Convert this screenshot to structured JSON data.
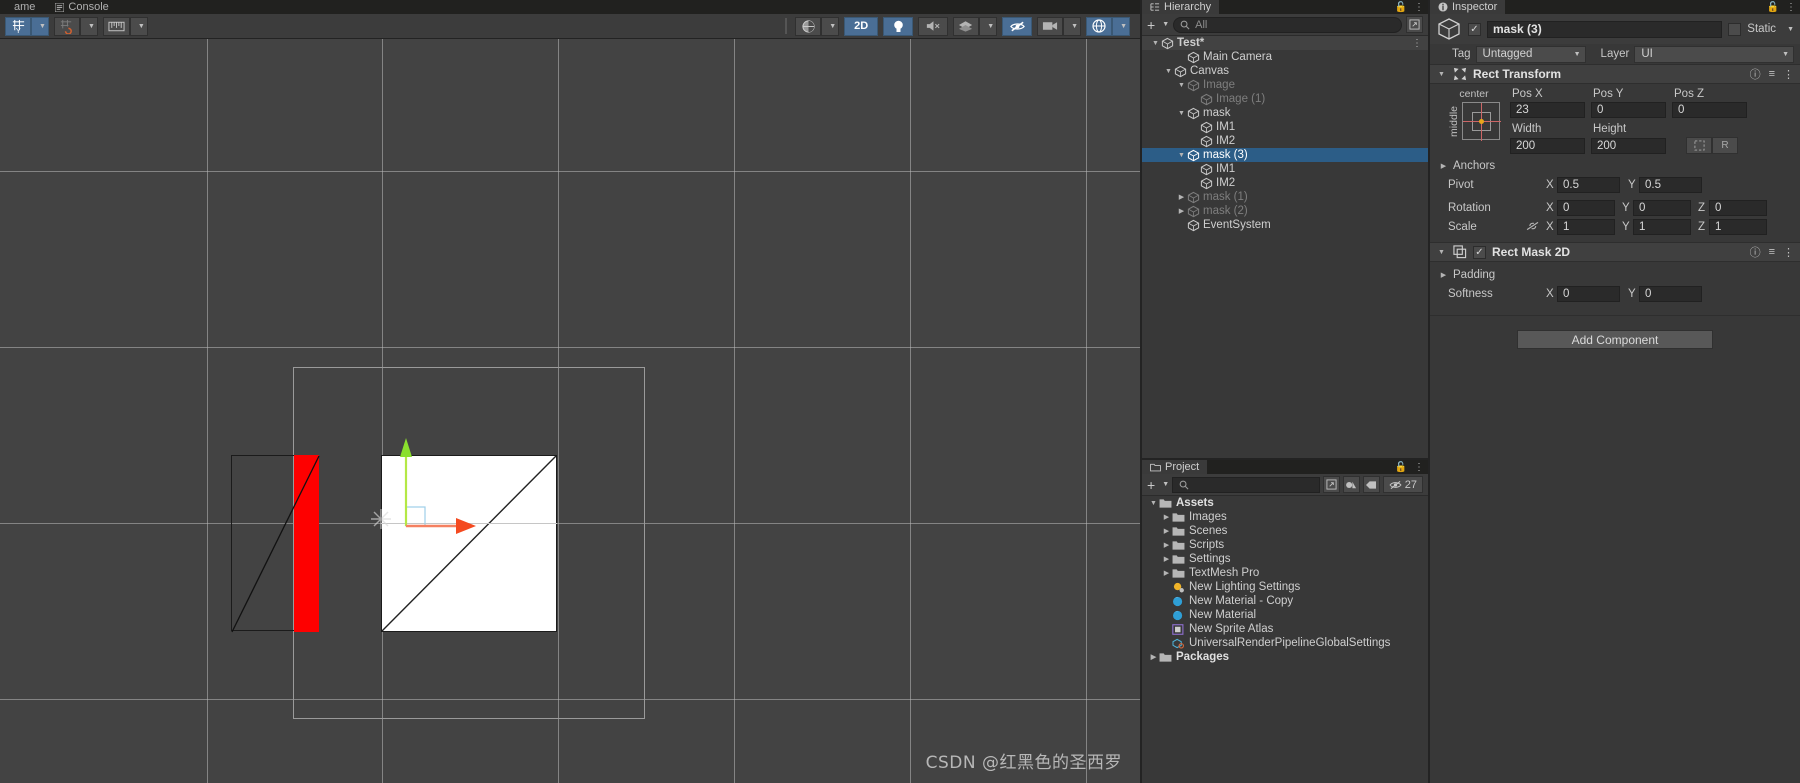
{
  "scene": {
    "tabs": [
      {
        "label": "ame",
        "icon": "scene-icon",
        "active": false
      },
      {
        "label": "Console",
        "icon": "console-icon",
        "active": false
      }
    ],
    "toolbar": {
      "grid_snap_label": "grid-snapping-icon",
      "snap_increment_label": "snap-increment-icon",
      "ruler_label": "ruler-icon",
      "draw_mode_label": "shaded-icon",
      "mode_2d_label": "2D",
      "lighting_label": "lighting-icon",
      "audio_label": "audio-mute-icon",
      "fx_label": "effects-icon",
      "hidden_label": "visibility-off-icon",
      "camera_label": "scene-camera-icon",
      "gizmos_label": "gizmos-icon"
    },
    "watermark": "CSDN @红黑色的圣西罗",
    "objects": {
      "canvas_outline": "canvas-rect",
      "masked_image_rect": "mask-rect",
      "red_strip": "red-image",
      "white_square": "selected-image",
      "gizmo_x_axis": "x-axis-arrow",
      "gizmo_y_axis": "y-axis-arrow",
      "gizmo_z_handle": "z-plane-handle"
    }
  },
  "hierarchy": {
    "tab_label": "Hierarchy",
    "add_label": "+",
    "search_placeholder": "All",
    "rows": [
      {
        "label": "Test*",
        "depth": 0,
        "twist": "down",
        "root": true,
        "selected": false,
        "faded": false,
        "unity_icon": true
      },
      {
        "label": "Main Camera",
        "depth": 2,
        "twist": "none",
        "root": false,
        "selected": false,
        "faded": false
      },
      {
        "label": "Canvas",
        "depth": 1,
        "twist": "down",
        "root": false,
        "selected": false,
        "faded": false
      },
      {
        "label": "Image",
        "depth": 2,
        "twist": "down",
        "root": false,
        "selected": false,
        "faded": true
      },
      {
        "label": "Image (1)",
        "depth": 3,
        "twist": "none",
        "root": false,
        "selected": false,
        "faded": true
      },
      {
        "label": "mask",
        "depth": 2,
        "twist": "down",
        "root": false,
        "selected": false,
        "faded": false
      },
      {
        "label": "IM1",
        "depth": 3,
        "twist": "none",
        "root": false,
        "selected": false,
        "faded": false
      },
      {
        "label": "IM2",
        "depth": 3,
        "twist": "none",
        "root": false,
        "selected": false,
        "faded": false
      },
      {
        "label": "mask (3)",
        "depth": 2,
        "twist": "down",
        "root": false,
        "selected": true,
        "faded": false
      },
      {
        "label": "IM1",
        "depth": 3,
        "twist": "none",
        "root": false,
        "selected": false,
        "faded": false
      },
      {
        "label": "IM2",
        "depth": 3,
        "twist": "none",
        "root": false,
        "selected": false,
        "faded": false
      },
      {
        "label": "mask (1)",
        "depth": 2,
        "twist": "right",
        "root": false,
        "selected": false,
        "faded": true
      },
      {
        "label": "mask (2)",
        "depth": 2,
        "twist": "right",
        "root": false,
        "selected": false,
        "faded": true
      },
      {
        "label": "EventSystem",
        "depth": 2,
        "twist": "none",
        "root": false,
        "selected": false,
        "faded": false
      }
    ]
  },
  "project": {
    "tab_label": "Project",
    "add_label": "+",
    "search_placeholder": "",
    "visible_count": "27",
    "rows": [
      {
        "label": "Assets",
        "depth": 0,
        "twist": "down",
        "icon": "folder",
        "bold": true
      },
      {
        "label": "Images",
        "depth": 1,
        "twist": "right",
        "icon": "folder",
        "bold": false
      },
      {
        "label": "Scenes",
        "depth": 1,
        "twist": "right",
        "icon": "folder",
        "bold": false
      },
      {
        "label": "Scripts",
        "depth": 1,
        "twist": "right",
        "icon": "folder",
        "bold": false
      },
      {
        "label": "Settings",
        "depth": 1,
        "twist": "right",
        "icon": "folder",
        "bold": false
      },
      {
        "label": "TextMesh Pro",
        "depth": 1,
        "twist": "right",
        "icon": "folder",
        "bold": false
      },
      {
        "label": "New Lighting Settings",
        "depth": 1,
        "twist": "none",
        "icon": "lighting",
        "bold": false
      },
      {
        "label": "New Material - Copy",
        "depth": 1,
        "twist": "none",
        "icon": "material",
        "bold": false
      },
      {
        "label": "New Material",
        "depth": 1,
        "twist": "none",
        "icon": "material",
        "bold": false
      },
      {
        "label": "New Sprite Atlas",
        "depth": 1,
        "twist": "none",
        "icon": "atlas",
        "bold": false
      },
      {
        "label": "UniversalRenderPipelineGlobalSettings",
        "depth": 1,
        "twist": "none",
        "icon": "urp",
        "bold": false
      },
      {
        "label": "Packages",
        "depth": 0,
        "twist": "right",
        "icon": "folder",
        "bold": true
      }
    ]
  },
  "inspector": {
    "tab_label": "Inspector",
    "object_name": "mask (3)",
    "enabled": true,
    "static_label": "Static",
    "tag_label": "Tag",
    "tag_value": "Untagged",
    "layer_label": "Layer",
    "layer_value": "UI",
    "rect_transform": {
      "title": "Rect Transform",
      "anchor_h_label": "center",
      "anchor_v_label": "middle",
      "pos_x_label": "Pos X",
      "pos_y_label": "Pos Y",
      "pos_z_label": "Pos Z",
      "pos_x": "23",
      "pos_y": "0",
      "pos_z": "0",
      "width_label": "Width",
      "height_label": "Height",
      "width": "200",
      "height": "200",
      "blueprint_label": "blueprint-icon",
      "raw_label": "R",
      "anchors_label": "Anchors",
      "pivot_label": "Pivot",
      "pivot_x": "0.5",
      "pivot_y": "0.5",
      "rotation_label": "Rotation",
      "rot_x": "0",
      "rot_y": "0",
      "rot_z": "0",
      "scale_label": "Scale",
      "scale_x": "1",
      "scale_y": "1",
      "scale_z": "1",
      "axis_x": "X",
      "axis_y": "Y",
      "axis_z": "Z"
    },
    "rect_mask_2d": {
      "title": "Rect Mask 2D",
      "enabled": true,
      "padding_label": "Padding",
      "softness_label": "Softness",
      "softness_x": "0",
      "softness_y": "0",
      "axis_x": "X",
      "axis_y": "Y"
    },
    "add_component_label": "Add Component"
  },
  "colors": {
    "accent_blue": "#2c5d87",
    "toolbar_blue": "#4a6e95",
    "red_image": "#fe0000",
    "panel_bg": "#383838",
    "viewport_bg": "#434343"
  }
}
